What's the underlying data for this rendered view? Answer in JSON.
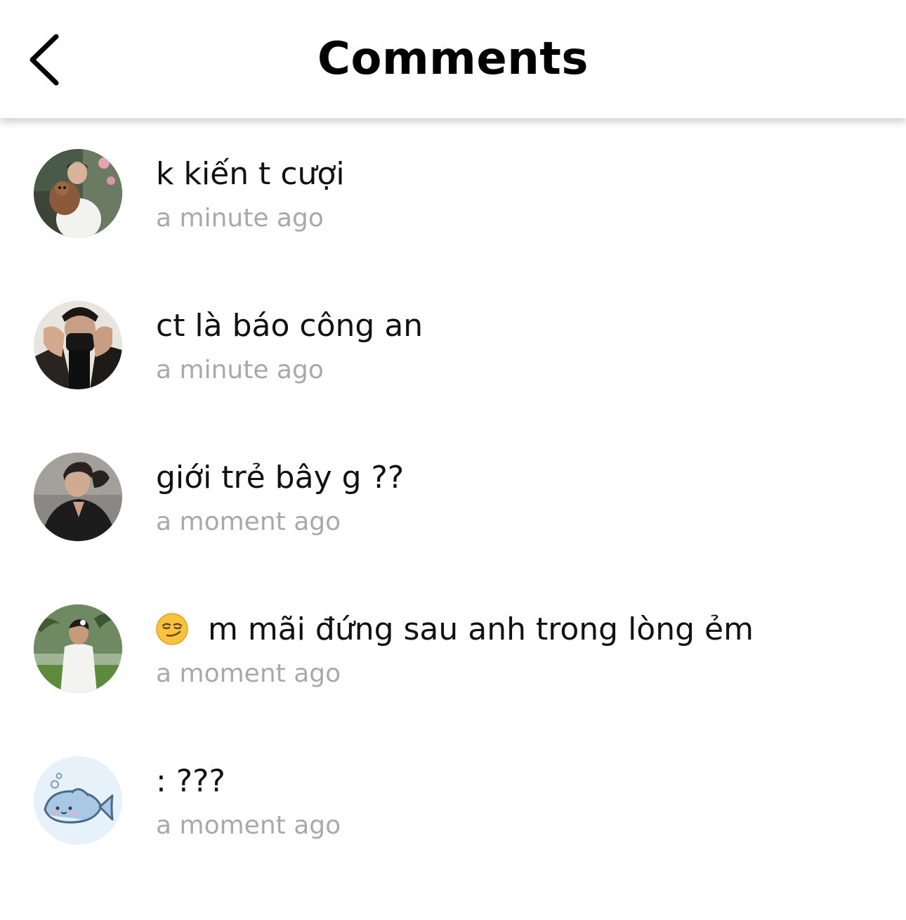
{
  "header": {
    "title": "Comments",
    "back_icon": "chevron-left-icon"
  },
  "comments": [
    {
      "text": "k kiến t cượi",
      "time": "a minute ago",
      "avatar": "photo-man-with-teddy-bear"
    },
    {
      "text": "ct là báo công an",
      "time": "a minute ago",
      "avatar": "photo-man-masked-hands"
    },
    {
      "text": "giới trẻ bây g ??",
      "time": "a moment ago",
      "avatar": "photo-man-black-shirt"
    },
    {
      "text": "m mãi đứng sau anh trong lòng ẻm",
      "time": "a moment ago",
      "avatar": "photo-man-garden",
      "emoji": "smirk-emoji"
    },
    {
      "text": ": ???",
      "time": "a moment ago",
      "avatar": "fish-cartoon-icon"
    }
  ],
  "colors": {
    "background": "#ffffff",
    "text": "#111111",
    "timestamp": "#a9a9a9",
    "fish_avatar_bg": "#e6f1fa"
  }
}
